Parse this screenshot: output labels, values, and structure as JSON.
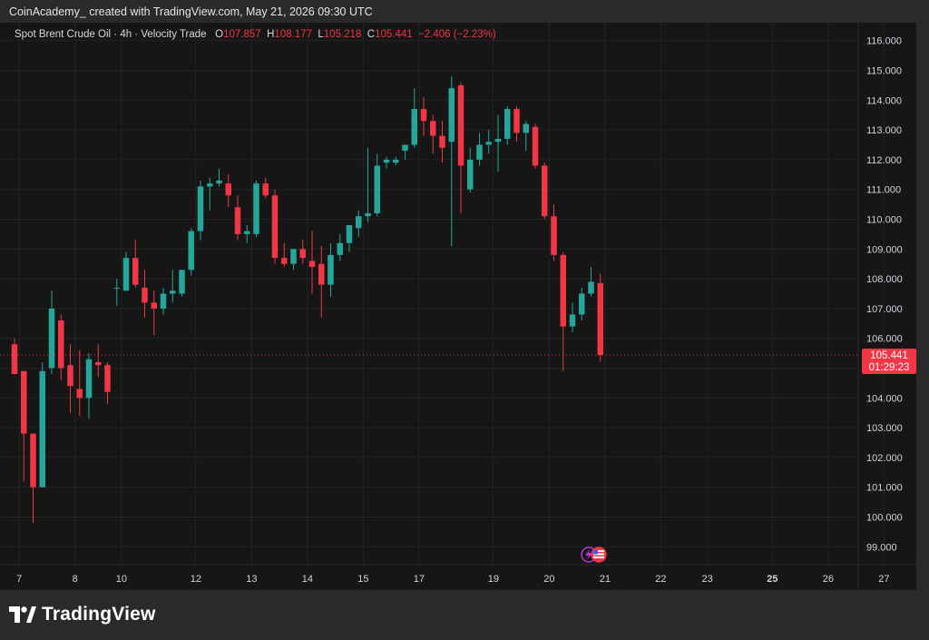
{
  "header": {
    "attribution": "CoinAcademy_ created with TradingView.com, May 21, 2026 09:30 UTC"
  },
  "legend": {
    "symbol": "Spot Brent Crude Oil · 4h · Velocity Trade",
    "o_label": "O",
    "o_value": "107.857",
    "h_label": "H",
    "h_value": "108.177",
    "l_label": "L",
    "l_value": "105.218",
    "c_label": "C",
    "c_value": "105.441",
    "change": "−2.406 (−2.23%)"
  },
  "price_badge": {
    "price": "105.441",
    "countdown": "01:29:23"
  },
  "footer": {
    "brand": "TradingView"
  },
  "colors": {
    "up": "#26a69a",
    "down": "#f23645",
    "background": "#161616",
    "grid": "#232323",
    "text": "#d1d4dc"
  },
  "icons": [
    "tradingview-logo-icon",
    "events-icon",
    "us-flag-icon"
  ],
  "chart_data": {
    "type": "candlestick",
    "title": "Spot Brent Crude Oil · 4h · Velocity Trade",
    "interval": "4h",
    "ylim": [
      98.4,
      116.6
    ],
    "y_ticks": [
      "99.000",
      "100.000",
      "101.000",
      "102.000",
      "103.000",
      "104.000",
      "105.000",
      "106.000",
      "107.000",
      "108.000",
      "109.000",
      "110.000",
      "111.000",
      "112.000",
      "113.000",
      "114.000",
      "115.000",
      "116.000"
    ],
    "x_ticks": [
      {
        "label": "7",
        "bar": 0.5
      },
      {
        "label": "8",
        "bar": 6.5
      },
      {
        "label": "10",
        "bar": 11.5
      },
      {
        "label": "12",
        "bar": 19.5
      },
      {
        "label": "13",
        "bar": 25.5
      },
      {
        "label": "14",
        "bar": 31.5
      },
      {
        "label": "15",
        "bar": 37.5
      },
      {
        "label": "17",
        "bar": 43.5
      },
      {
        "label": "19",
        "bar": 51.5
      },
      {
        "label": "20",
        "bar": 57.5
      },
      {
        "label": "21",
        "bar": 63.5
      },
      {
        "label": "22",
        "bar": 69.5
      },
      {
        "label": "23",
        "bar": 74.5
      },
      {
        "label": "25",
        "bar": 81.5,
        "bold": true
      },
      {
        "label": "26",
        "bar": 87.5
      },
      {
        "label": "27",
        "bar": 93.5
      }
    ],
    "grid": true,
    "last_price": 105.441,
    "candles": [
      {
        "o": 105.8,
        "h": 106.0,
        "l": 104.8,
        "c": 104.8
      },
      {
        "o": 104.9,
        "h": 104.9,
        "l": 101.2,
        "c": 102.8
      },
      {
        "o": 102.8,
        "h": 102.8,
        "l": 99.8,
        "c": 101.0
      },
      {
        "o": 101.0,
        "h": 105.2,
        "l": 101.0,
        "c": 104.9
      },
      {
        "o": 105.0,
        "h": 107.6,
        "l": 104.8,
        "c": 107.0
      },
      {
        "o": 106.6,
        "h": 106.8,
        "l": 104.6,
        "c": 105.0
      },
      {
        "o": 105.1,
        "h": 105.8,
        "l": 103.5,
        "c": 104.4
      },
      {
        "o": 104.3,
        "h": 105.6,
        "l": 103.4,
        "c": 104.0
      },
      {
        "o": 104.0,
        "h": 105.5,
        "l": 103.3,
        "c": 105.3
      },
      {
        "o": 105.2,
        "h": 105.8,
        "l": 104.7,
        "c": 105.1
      },
      {
        "o": 105.1,
        "h": 105.2,
        "l": 103.8,
        "c": 104.2
      },
      {
        "o": 107.7,
        "h": 108.0,
        "l": 107.1,
        "c": 107.7
      },
      {
        "o": 107.6,
        "h": 108.9,
        "l": 107.6,
        "c": 108.7
      },
      {
        "o": 108.7,
        "h": 109.3,
        "l": 107.7,
        "c": 107.8
      },
      {
        "o": 107.7,
        "h": 108.3,
        "l": 106.7,
        "c": 107.2
      },
      {
        "o": 107.2,
        "h": 107.6,
        "l": 106.1,
        "c": 107.0
      },
      {
        "o": 107.0,
        "h": 107.7,
        "l": 106.8,
        "c": 107.5
      },
      {
        "o": 107.5,
        "h": 108.3,
        "l": 107.2,
        "c": 107.6
      },
      {
        "o": 107.5,
        "h": 108.3,
        "l": 107.4,
        "c": 108.3
      },
      {
        "o": 108.3,
        "h": 109.7,
        "l": 108.1,
        "c": 109.6
      },
      {
        "o": 109.6,
        "h": 111.3,
        "l": 109.3,
        "c": 111.1
      },
      {
        "o": 111.1,
        "h": 111.4,
        "l": 110.3,
        "c": 111.2
      },
      {
        "o": 111.2,
        "h": 111.7,
        "l": 111.1,
        "c": 111.3
      },
      {
        "o": 111.2,
        "h": 111.5,
        "l": 110.4,
        "c": 110.8
      },
      {
        "o": 110.4,
        "h": 110.8,
        "l": 109.3,
        "c": 109.5
      },
      {
        "o": 109.5,
        "h": 109.8,
        "l": 109.2,
        "c": 109.6
      },
      {
        "o": 109.5,
        "h": 111.3,
        "l": 109.4,
        "c": 111.2
      },
      {
        "o": 111.2,
        "h": 111.4,
        "l": 110.7,
        "c": 110.8
      },
      {
        "o": 110.8,
        "h": 111.0,
        "l": 108.5,
        "c": 108.7
      },
      {
        "o": 108.7,
        "h": 109.2,
        "l": 108.4,
        "c": 108.5
      },
      {
        "o": 108.5,
        "h": 109.0,
        "l": 108.3,
        "c": 109.0
      },
      {
        "o": 109.0,
        "h": 109.3,
        "l": 108.5,
        "c": 108.7
      },
      {
        "o": 108.6,
        "h": 109.6,
        "l": 107.5,
        "c": 108.4
      },
      {
        "o": 108.5,
        "h": 109.1,
        "l": 106.7,
        "c": 107.8
      },
      {
        "o": 107.8,
        "h": 109.2,
        "l": 107.4,
        "c": 108.8
      },
      {
        "o": 108.8,
        "h": 109.5,
        "l": 108.6,
        "c": 109.2
      },
      {
        "o": 109.2,
        "h": 109.8,
        "l": 108.9,
        "c": 109.8
      },
      {
        "o": 109.7,
        "h": 110.3,
        "l": 109.4,
        "c": 110.1
      },
      {
        "o": 110.1,
        "h": 112.4,
        "l": 109.9,
        "c": 110.2
      },
      {
        "o": 110.2,
        "h": 112.2,
        "l": 110.1,
        "c": 111.8
      },
      {
        "o": 111.9,
        "h": 112.1,
        "l": 111.7,
        "c": 112.0
      },
      {
        "o": 111.9,
        "h": 112.1,
        "l": 111.8,
        "c": 112.0
      },
      {
        "o": 112.3,
        "h": 112.5,
        "l": 112.0,
        "c": 112.5
      },
      {
        "o": 112.5,
        "h": 114.4,
        "l": 112.4,
        "c": 113.7
      },
      {
        "o": 113.7,
        "h": 114.1,
        "l": 112.8,
        "c": 113.3
      },
      {
        "o": 113.3,
        "h": 113.5,
        "l": 112.2,
        "c": 112.8
      },
      {
        "o": 112.8,
        "h": 113.3,
        "l": 111.9,
        "c": 112.4
      },
      {
        "o": 112.6,
        "h": 114.8,
        "l": 109.1,
        "c": 114.4
      },
      {
        "o": 114.5,
        "h": 114.6,
        "l": 110.2,
        "c": 111.8
      },
      {
        "o": 111.0,
        "h": 112.4,
        "l": 110.9,
        "c": 112.0
      },
      {
        "o": 112.0,
        "h": 112.9,
        "l": 111.8,
        "c": 112.5
      },
      {
        "o": 112.5,
        "h": 113.0,
        "l": 112.2,
        "c": 112.6
      },
      {
        "o": 112.6,
        "h": 113.5,
        "l": 111.6,
        "c": 112.7
      },
      {
        "o": 112.7,
        "h": 113.8,
        "l": 112.5,
        "c": 113.7
      },
      {
        "o": 113.7,
        "h": 113.8,
        "l": 112.6,
        "c": 112.9
      },
      {
        "o": 112.9,
        "h": 113.3,
        "l": 112.3,
        "c": 113.2
      },
      {
        "o": 113.1,
        "h": 113.2,
        "l": 111.7,
        "c": 111.8
      },
      {
        "o": 111.8,
        "h": 111.9,
        "l": 110.0,
        "c": 110.1
      },
      {
        "o": 110.1,
        "h": 110.5,
        "l": 108.6,
        "c": 108.8
      },
      {
        "o": 108.8,
        "h": 108.9,
        "l": 104.9,
        "c": 106.4
      },
      {
        "o": 106.4,
        "h": 107.2,
        "l": 106.2,
        "c": 106.8
      },
      {
        "o": 106.8,
        "h": 107.7,
        "l": 106.6,
        "c": 107.5
      },
      {
        "o": 107.5,
        "h": 108.4,
        "l": 107.4,
        "c": 107.9
      },
      {
        "o": 107.857,
        "h": 108.177,
        "l": 105.218,
        "c": 105.441
      }
    ]
  }
}
